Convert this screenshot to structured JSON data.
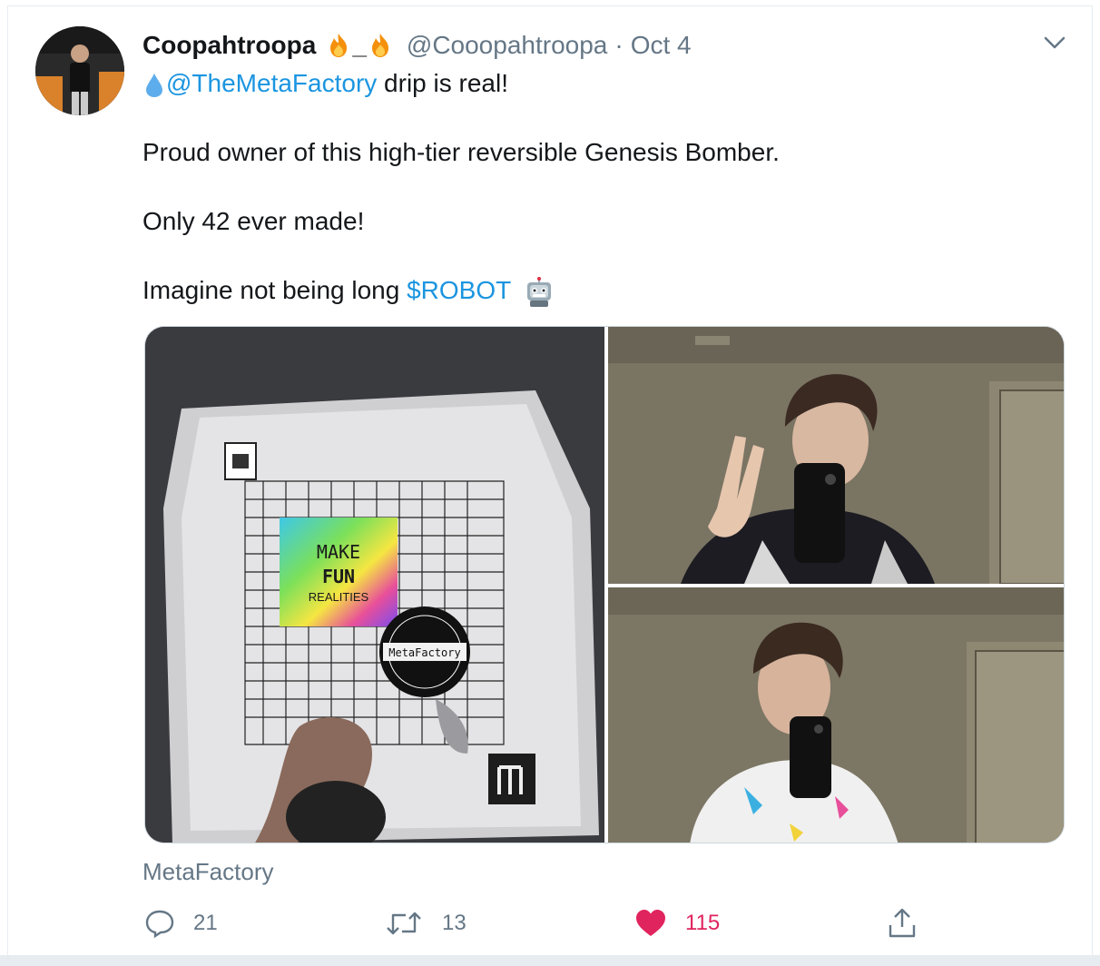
{
  "tweet": {
    "display_name": "Coopahtroopa",
    "name_decoration": "_",
    "handle": "@Cooopahtroopa",
    "separator": "·",
    "date": "Oct 4",
    "lines": {
      "mention": "@TheMetaFactory",
      "line1_rest": " drip is real!",
      "line2": "Proud owner of this high-tier reversible Genesis Bomber.",
      "line3": "Only 42 ever made!",
      "line4_prefix": "Imagine not being long ",
      "cashtag": "$ROBOT"
    },
    "source": "MetaFactory",
    "counts": {
      "replies": "21",
      "retweets": "13",
      "likes": "115"
    },
    "media": {
      "bag_labels": {
        "make": "MAKE",
        "fun": "FUN",
        "realities": "REALITIES",
        "badge": "MetaFactory"
      }
    }
  },
  "colors": {
    "link": "#1b95e0",
    "like": "#e0245e",
    "muted": "#657786"
  },
  "icons": [
    "fire-icon",
    "droplet-icon",
    "robot-icon",
    "chevron-down-icon",
    "reply-icon",
    "retweet-icon",
    "heart-icon",
    "share-icon"
  ]
}
